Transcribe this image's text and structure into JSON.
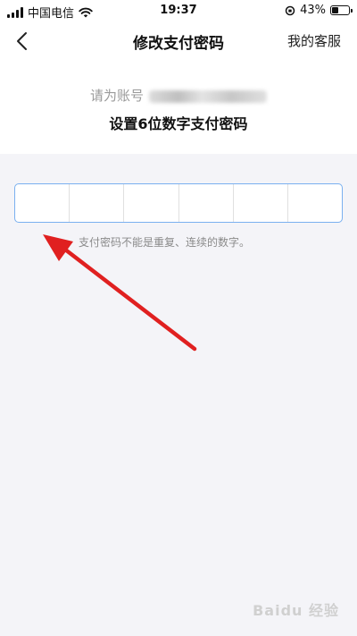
{
  "status_bar": {
    "carrier": "中国电信",
    "time": "19:37",
    "battery": "43%",
    "battery_level": 0.43,
    "icons": [
      "signal-icon",
      "wifi-icon",
      "orientation-lock-icon",
      "battery-icon"
    ]
  },
  "nav": {
    "title": "修改支付密码",
    "right_label": "我的客服",
    "back_icon": "chevron-left-icon"
  },
  "header": {
    "account_prefix": "请为账号",
    "instruction": "设置6位数字支付密码"
  },
  "pin": {
    "cells": [
      "",
      "",
      "",
      "",
      "",
      ""
    ],
    "accent": "#7ab0f0"
  },
  "hint": "支付密码不能是重复、连续的数字。",
  "annotation": {
    "arrow_color": "#e02020"
  },
  "watermark": "Baidu 经验"
}
